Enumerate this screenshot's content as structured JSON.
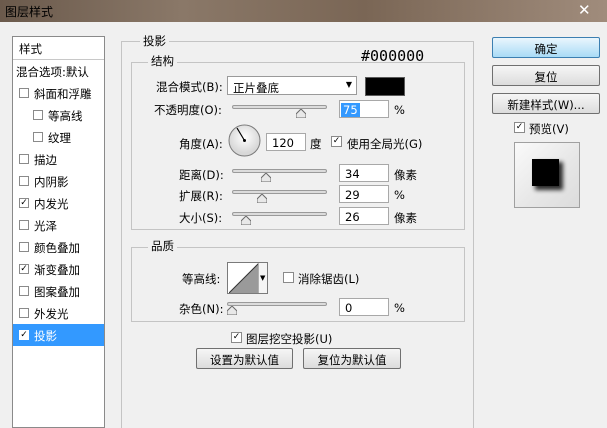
{
  "window": {
    "title": "图层样式",
    "close_icon": "close-icon"
  },
  "left_panel": {
    "header": "样式",
    "items": [
      {
        "label": "混合选项:默认",
        "checkbox": false,
        "checked": false,
        "selected": false,
        "indent": 0
      },
      {
        "label": "斜面和浮雕",
        "checkbox": true,
        "checked": false,
        "selected": false,
        "indent": 0
      },
      {
        "label": "等高线",
        "checkbox": true,
        "checked": false,
        "selected": false,
        "indent": 1
      },
      {
        "label": "纹理",
        "checkbox": true,
        "checked": false,
        "selected": false,
        "indent": 1
      },
      {
        "label": "描边",
        "checkbox": true,
        "checked": false,
        "selected": false,
        "indent": 0
      },
      {
        "label": "内阴影",
        "checkbox": true,
        "checked": false,
        "selected": false,
        "indent": 0
      },
      {
        "label": "内发光",
        "checkbox": true,
        "checked": true,
        "selected": false,
        "indent": 0
      },
      {
        "label": "光泽",
        "checkbox": true,
        "checked": false,
        "selected": false,
        "indent": 0
      },
      {
        "label": "颜色叠加",
        "checkbox": true,
        "checked": false,
        "selected": false,
        "indent": 0
      },
      {
        "label": "渐变叠加",
        "checkbox": true,
        "checked": true,
        "selected": false,
        "indent": 0
      },
      {
        "label": "图案叠加",
        "checkbox": true,
        "checked": false,
        "selected": false,
        "indent": 0
      },
      {
        "label": "外发光",
        "checkbox": true,
        "checked": false,
        "selected": false,
        "indent": 0
      },
      {
        "label": "投影",
        "checkbox": true,
        "checked": true,
        "selected": true,
        "indent": 0
      }
    ]
  },
  "main": {
    "section_title": "投影",
    "structure": {
      "title": "结构",
      "color_hex_label": "#000000",
      "blend_mode": {
        "label": "混合模式(B):",
        "value": "正片叠底"
      },
      "opacity": {
        "label": "不透明度(O):",
        "value": "75",
        "unit": "%",
        "fraction": 0.75
      },
      "angle": {
        "label": "角度(A):",
        "value": "120",
        "unit": "度",
        "global_light_label": "使用全局光(G)",
        "global_light_checked": true
      },
      "distance": {
        "label": "距离(D):",
        "value": "34",
        "unit": "像素",
        "fraction": 0.34
      },
      "spread": {
        "label": "扩展(R):",
        "value": "29",
        "unit": "%",
        "fraction": 0.29
      },
      "size": {
        "label": "大小(S):",
        "value": "26",
        "unit": "像素",
        "fraction": 0.1
      }
    },
    "quality": {
      "title": "品质",
      "contour_label": "等高线:",
      "anti_alias_label": "消除锯齿(L)",
      "anti_alias_checked": false,
      "noise": {
        "label": "杂色(N):",
        "value": "0",
        "unit": "%",
        "fraction": 0
      }
    },
    "knockout_label": "图层挖空投影(U)",
    "knockout_checked": true,
    "make_default": "设置为默认值",
    "reset_default": "复位为默认值"
  },
  "right": {
    "ok": "确定",
    "reset": "复位",
    "new_style": "新建样式(W)...",
    "preview_label": "预览(V)",
    "preview_checked": true
  },
  "colors": {
    "selected": "#3399ff",
    "shadow_color": "#000000"
  }
}
